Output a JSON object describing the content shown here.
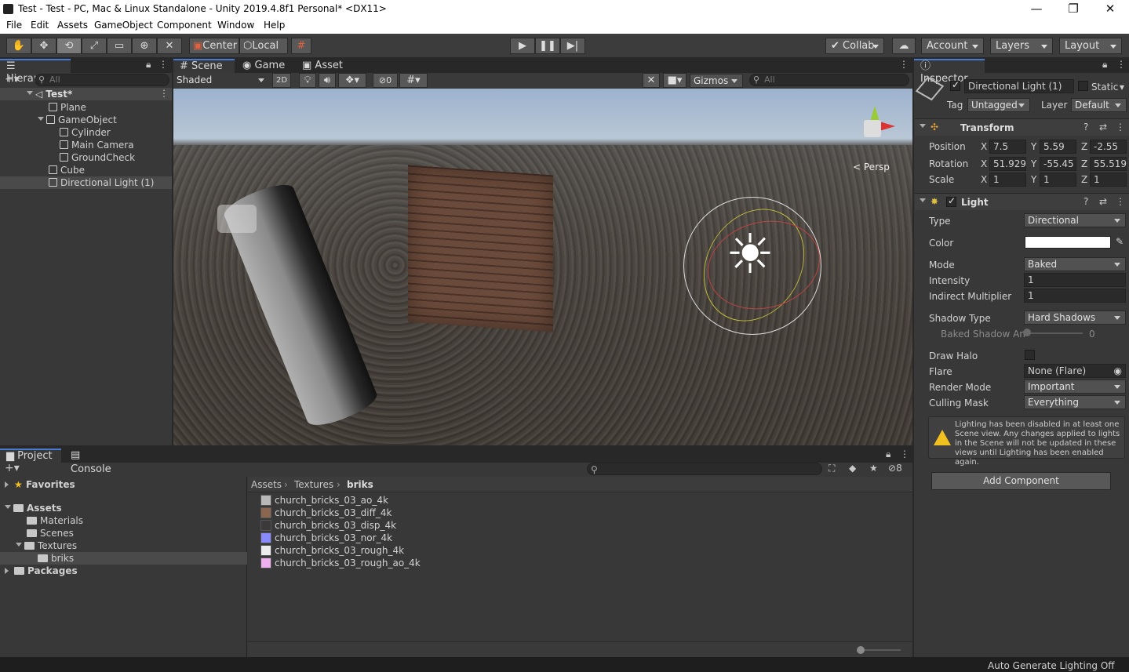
{
  "window": {
    "title": "Test - Test - PC, Mac & Linux Standalone - Unity 2019.4.8f1 Personal* <DX11>",
    "minimize": "—",
    "maximize": "❐",
    "close": "✕"
  },
  "menu": [
    "File",
    "Edit",
    "Assets",
    "GameObject",
    "Component",
    "Window",
    "Help"
  ],
  "toolbar": {
    "pivot": "Center",
    "space": "Local",
    "collab": "Collab",
    "account": "Account",
    "layers": "Layers",
    "layout": "Layout"
  },
  "hierarchy": {
    "tab": "Hierarchy",
    "search_placeholder": "All",
    "scene": "Test*",
    "items": [
      {
        "label": "Plane",
        "depth": 1
      },
      {
        "label": "GameObject",
        "depth": 1
      },
      {
        "label": "Cylinder",
        "depth": 2
      },
      {
        "label": "Main Camera",
        "depth": 2
      },
      {
        "label": "GroundCheck",
        "depth": 2
      },
      {
        "label": "Cube",
        "depth": 1
      },
      {
        "label": "Directional Light (1)",
        "depth": 1
      }
    ]
  },
  "scene_view": {
    "tabs": [
      "Scene",
      "Game",
      "Asset Store"
    ],
    "shading": "Shaded",
    "mode_2d": "2D",
    "hidden_count": "0",
    "gizmos": "Gizmos",
    "search_placeholder": "All",
    "projection": "Persp"
  },
  "inspector": {
    "tab": "Inspector",
    "object_name": "Directional Light (1)",
    "static_label": "Static",
    "tag_label": "Tag",
    "tag": "Untagged",
    "layer_label": "Layer",
    "layer": "Default",
    "transform": {
      "title": "Transform",
      "position": {
        "label": "Position",
        "x": "7.5",
        "y": "5.59",
        "z": "-2.55"
      },
      "rotation": {
        "label": "Rotation",
        "x": "51.929",
        "y": "-55.45",
        "z": "55.519"
      },
      "scale": {
        "label": "Scale",
        "x": "1",
        "y": "1",
        "z": "1"
      }
    },
    "light": {
      "title": "Light",
      "type_label": "Type",
      "type": "Directional",
      "color_label": "Color",
      "color": "#ffffff",
      "mode_label": "Mode",
      "mode": "Baked",
      "intensity_label": "Intensity",
      "intensity": "1",
      "indirect_label": "Indirect Multiplier",
      "indirect": "1",
      "shadow_type_label": "Shadow Type",
      "shadow_type": "Hard Shadows",
      "baked_angle_label": "Baked Shadow An",
      "baked_angle": "0",
      "draw_halo_label": "Draw Halo",
      "flare_label": "Flare",
      "flare": "None (Flare)",
      "render_mode_label": "Render Mode",
      "render_mode": "Important",
      "culling_label": "Culling Mask",
      "culling": "Everything",
      "warning": "Lighting has been disabled in at least one Scene view. Any changes applied to lights in the Scene will not be updated in these views until Lighting has been enabled again."
    },
    "add_component": "Add Component"
  },
  "project": {
    "tabs": [
      "Project",
      "Console"
    ],
    "hidden_count": "8",
    "tree": {
      "favorites": "Favorites",
      "assets": "Assets",
      "materials": "Materials",
      "scenes": "Scenes",
      "textures": "Textures",
      "briks": "briks",
      "packages": "Packages"
    },
    "breadcrumb": [
      "Assets",
      "Textures",
      "briks"
    ],
    "files": [
      {
        "name": "church_bricks_03_ao_4k",
        "color": "#b8b8b8"
      },
      {
        "name": "church_bricks_03_diff_4k",
        "color": "#8a6650"
      },
      {
        "name": "church_bricks_03_disp_4k",
        "color": "#3a3a3a"
      },
      {
        "name": "church_bricks_03_nor_4k",
        "color": "#8a8aff"
      },
      {
        "name": "church_bricks_03_rough_4k",
        "color": "#ececec"
      },
      {
        "name": "church_bricks_03_rough_ao_4k",
        "color": "#f0b0f0"
      }
    ]
  },
  "status": {
    "text": "Auto Generate Lighting Off"
  }
}
